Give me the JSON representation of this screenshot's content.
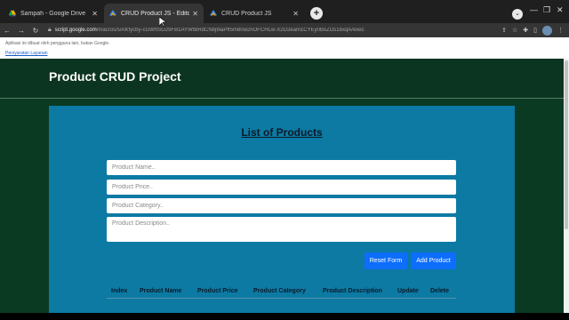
{
  "browser": {
    "tabs": [
      {
        "title": "Sampah - Google Drive",
        "icon": "google-drive-icon",
        "active": false
      },
      {
        "title": "CRUD Product JS - Editor Project",
        "icon": "apps-script-icon",
        "active": true
      },
      {
        "title": "CRUD Product JS",
        "icon": "apps-script-icon",
        "active": false
      }
    ],
    "url_host": "script.google.com",
    "url_path": "/macros/s/AKfycby-cGWfISG29FB1AYWtBRdCNbj9iaPff5m80w2nOFCHLw-X2D2eam1CYEy0BxZOs1bxqA/exec",
    "notice": "Aplikasi ini dibuat oleh pengguna lain, bukan Google.",
    "terms_link": "Persyaratan Layanan"
  },
  "app": {
    "title": "Product CRUD Project",
    "list_title": "List of Products",
    "form": {
      "name_placeholder": "Product Name..",
      "price_placeholder": "Product Price..",
      "category_placeholder": "Product Category..",
      "description_placeholder": "Product Description.."
    },
    "buttons": {
      "reset": "Reset Form",
      "add": "Add Product"
    },
    "table_headers": [
      "Index",
      "Product Name",
      "Product Price",
      "Product Category",
      "Product Description",
      "Update",
      "Delete"
    ]
  },
  "colors": {
    "page_bg": "#0b3a22",
    "panel_bg": "#0c7aa3",
    "button_bg": "#0d6efd"
  }
}
